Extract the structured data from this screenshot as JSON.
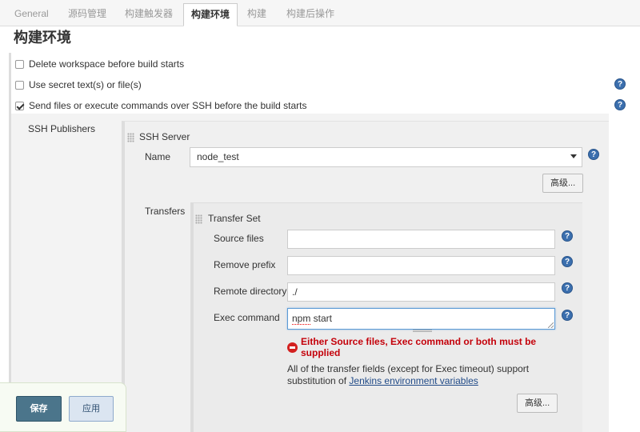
{
  "tabs": [
    {
      "label": "General",
      "active": false
    },
    {
      "label": "源码管理",
      "active": false
    },
    {
      "label": "构建触发器",
      "active": false
    },
    {
      "label": "构建环境",
      "active": true
    },
    {
      "label": "构建",
      "active": false
    },
    {
      "label": "构建后操作",
      "active": false
    }
  ],
  "section_title": "构建环境",
  "options": [
    {
      "label": "Delete workspace before build starts",
      "checked": false
    },
    {
      "label": "Use secret text(s) or file(s)",
      "checked": false
    },
    {
      "label": "Send files or execute commands over SSH before the build starts",
      "checked": true
    }
  ],
  "ssh_publishers": {
    "label": "SSH Publishers",
    "server_heading": "SSH Server",
    "name_label": "Name",
    "name_value": "node_test",
    "advanced_label": "高级...",
    "transfers_label": "Transfers",
    "transfer_set": {
      "heading": "Transfer Set",
      "source_files_label": "Source files",
      "source_files_value": "",
      "remove_prefix_label": "Remove prefix",
      "remove_prefix_value": "",
      "remote_directory_label": "Remote directory",
      "remote_directory_value": "./",
      "exec_command_label": "Exec command",
      "exec_command_word1": "npm",
      "exec_command_word2": " start",
      "error_message": "Either Source files, Exec command or both must be supplied",
      "info_text": "All of the transfer fields (except for Exec timeout) support substitution of ",
      "info_link": "Jenkins environment variables",
      "advanced_label": "高级..."
    }
  },
  "buttons": {
    "save": "保存",
    "apply": "应用"
  },
  "icons": {
    "help": "?"
  },
  "colors": {
    "save_button": "#4b758b",
    "error": "#c4000a",
    "help_icon": "#3b6fae",
    "link": "#204a87"
  }
}
